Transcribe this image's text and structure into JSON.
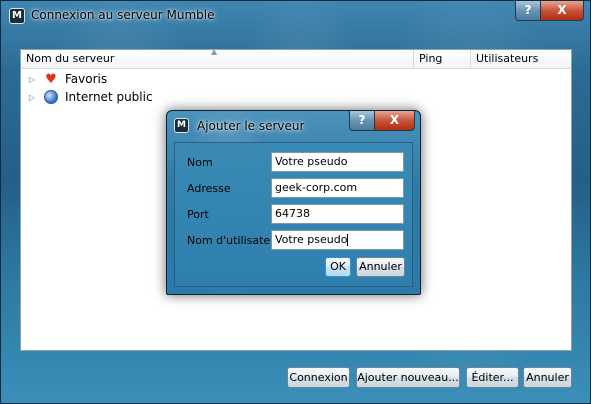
{
  "window": {
    "title": "Connexion au serveur Mumble",
    "help_label": "?",
    "close_label": "X"
  },
  "server_list": {
    "columns": [
      "Nom du serveur",
      "Ping",
      "Utilisateurs"
    ],
    "items": [
      {
        "label": "Favoris",
        "icon": "heart-icon"
      },
      {
        "label": "Internet public",
        "icon": "globe-icon"
      }
    ]
  },
  "buttons": {
    "connect": "Connexion",
    "add_new": "Ajouter nouveau...",
    "edit": "Éditer...",
    "cancel": "Annuler"
  },
  "dialog": {
    "title": "Ajouter le serveur",
    "help_label": "?",
    "close_label": "X",
    "fields": [
      {
        "label": "Nom",
        "value": "Votre pseudo"
      },
      {
        "label": "Adresse",
        "value": "geek-corp.com"
      },
      {
        "label": "Port",
        "value": "64738"
      },
      {
        "label": "Nom d'utilisateur",
        "value": "Votre pseudo"
      }
    ],
    "ok_label": "OK",
    "cancel_label": "Annuler"
  },
  "colors": {
    "heart": "#e03020",
    "glass_blue": "#2f7aa6",
    "close_red": "#c7553a"
  }
}
